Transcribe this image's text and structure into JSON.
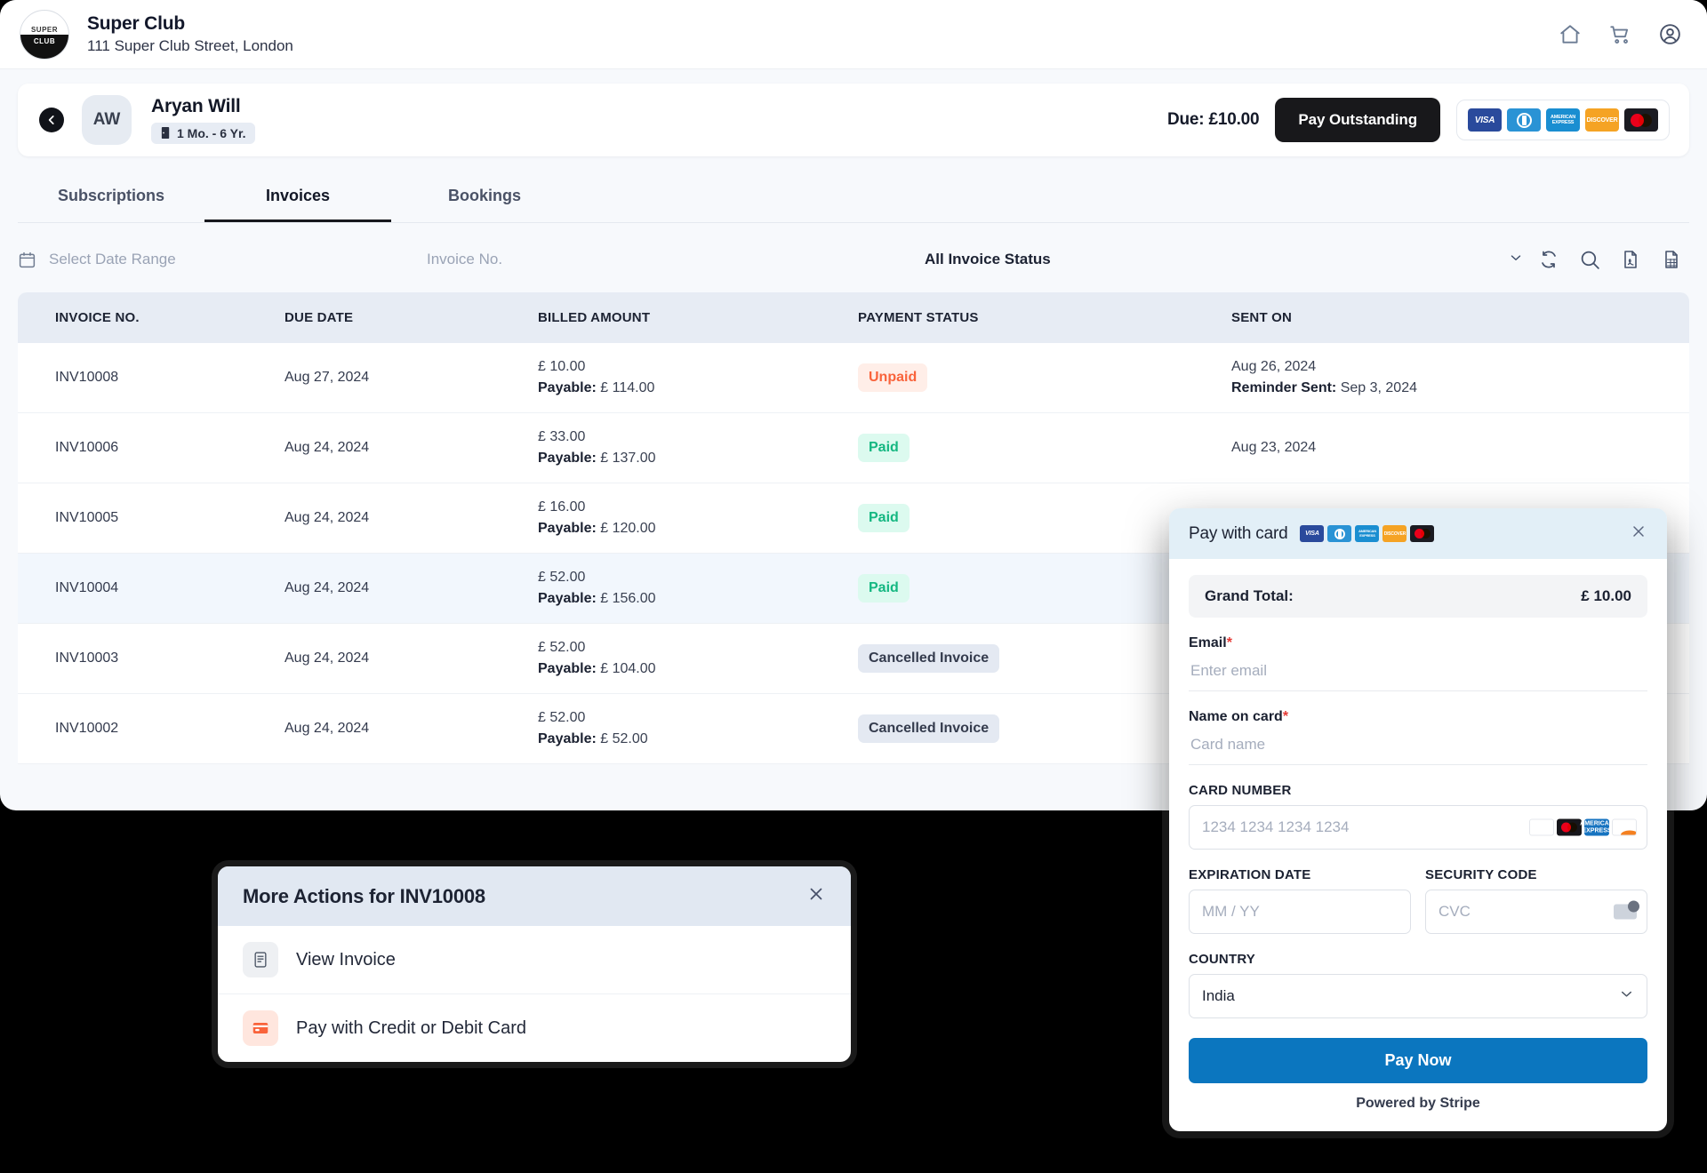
{
  "brand": {
    "logo_line1": "SUPER",
    "logo_line2": "CLUB",
    "name": "Super Club",
    "address": "111 Super Club Street, London",
    "icons": [
      "home-icon",
      "cart-icon",
      "account-icon"
    ]
  },
  "member": {
    "initials": "AW",
    "name": "Aryan Will",
    "age_range": "1 Mo. - 6 Yr.",
    "due_label": "Due: £10.00",
    "pay_outstanding": "Pay Outstanding",
    "accepted_cards": [
      "VISA",
      "DINERS",
      "AMERICAN EXPRESS",
      "DISCOVER",
      "MASTERCARD"
    ]
  },
  "tabs": [
    {
      "label": "Subscriptions",
      "active": false
    },
    {
      "label": "Invoices",
      "active": true
    },
    {
      "label": "Bookings",
      "active": false
    }
  ],
  "filters": {
    "date_placeholder": "Select Date Range",
    "invoice_placeholder": "Invoice No.",
    "status_selected": "All Invoice Status",
    "actions": [
      "refresh-icon",
      "search-icon",
      "pdf-export-icon",
      "excel-export-icon"
    ]
  },
  "table": {
    "columns": [
      "INVOICE NO.",
      "DUE DATE",
      "BILLED AMOUNT",
      "PAYMENT STATUS",
      "SENT ON"
    ],
    "payable_label": "Payable:",
    "reminder_label": "Reminder Sent:",
    "rows": [
      {
        "invoice_no": "INV10008",
        "due_date": "Aug 27, 2024",
        "billed": "£ 10.00",
        "payable": "£ 114.00",
        "status": "Unpaid",
        "status_kind": "unpaid",
        "sent_on": "Aug 26, 2024",
        "reminder_sent": "Sep 3, 2024",
        "highlight": false
      },
      {
        "invoice_no": "INV10006",
        "due_date": "Aug 24, 2024",
        "billed": "£ 33.00",
        "payable": "£ 137.00",
        "status": "Paid",
        "status_kind": "paid",
        "sent_on": "Aug 23, 2024",
        "reminder_sent": "",
        "highlight": false
      },
      {
        "invoice_no": "INV10005",
        "due_date": "Aug 24, 2024",
        "billed": "£ 16.00",
        "payable": "£ 120.00",
        "status": "Paid",
        "status_kind": "paid",
        "sent_on": "",
        "reminder_sent": "",
        "highlight": false
      },
      {
        "invoice_no": "INV10004",
        "due_date": "Aug 24, 2024",
        "billed": "£ 52.00",
        "payable": "£ 156.00",
        "status": "Paid",
        "status_kind": "paid",
        "sent_on": "",
        "reminder_sent": "",
        "highlight": true
      },
      {
        "invoice_no": "INV10003",
        "due_date": "Aug 24, 2024",
        "billed": "£ 52.00",
        "payable": "£ 104.00",
        "status": "Cancelled Invoice",
        "status_kind": "cancel",
        "sent_on": "",
        "reminder_sent": "",
        "highlight": false
      },
      {
        "invoice_no": "INV10002",
        "due_date": "Aug 24, 2024",
        "billed": "£ 52.00",
        "payable": "£ 52.00",
        "status": "Cancelled Invoice",
        "status_kind": "cancel",
        "sent_on": "",
        "reminder_sent": "",
        "highlight": false
      }
    ]
  },
  "more_actions": {
    "title": "More Actions for INV10008",
    "items": [
      {
        "label": "View Invoice",
        "icon": "document-icon",
        "tone": "gray"
      },
      {
        "label": "Pay with Credit or Debit Card",
        "icon": "credit-card-icon",
        "tone": "red"
      }
    ]
  },
  "stripe": {
    "title": "Pay with card",
    "grand_total_label": "Grand Total:",
    "grand_total_value": "£ 10.00",
    "email_label": "Email",
    "email_placeholder": "Enter email",
    "email_value": "",
    "name_label": "Name on card",
    "name_placeholder": "Card name",
    "name_value": "",
    "card_number_label": "CARD NUMBER",
    "card_number_placeholder": "1234 1234 1234 1234",
    "card_number_value": "",
    "expiry_label": "EXPIRATION DATE",
    "expiry_placeholder": "MM / YY",
    "expiry_value": "",
    "cvc_label": "SECURITY CODE",
    "cvc_placeholder": "CVC",
    "cvc_value": "",
    "country_label": "COUNTRY",
    "country_value": "India",
    "pay_now": "Pay Now",
    "footer": "Powered by Stripe",
    "required_mark": "*"
  },
  "colors": {
    "accent_dark": "#18181b",
    "stripe_blue": "#0b76bf",
    "unpaid": "#f9633b",
    "paid": "#14b781",
    "cancelled": "#343b4d",
    "page_bg": "#f7f9fc"
  }
}
